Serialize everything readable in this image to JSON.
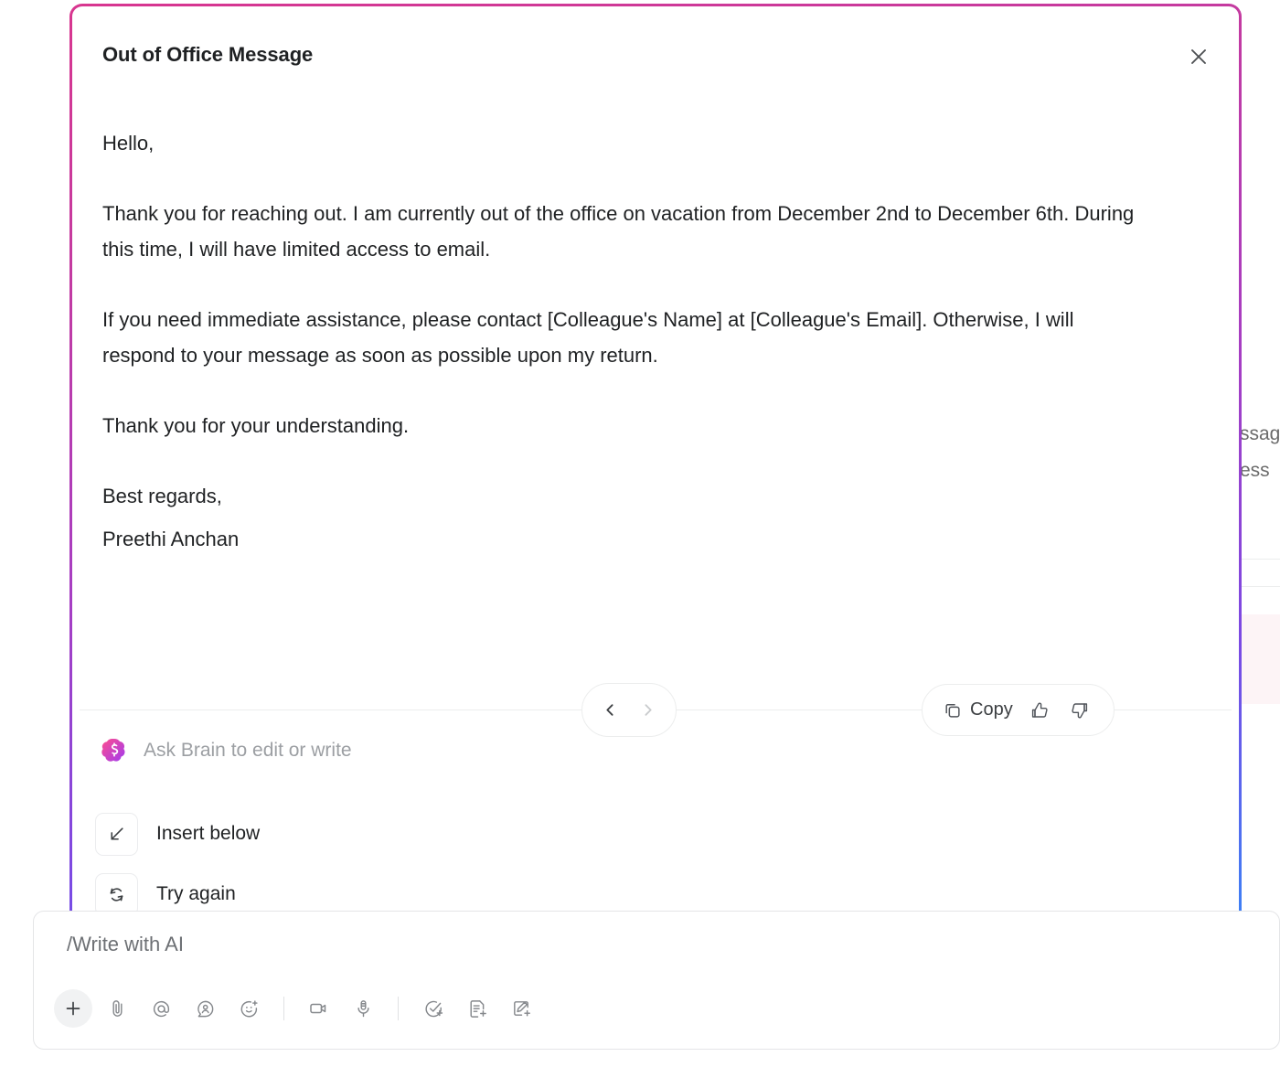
{
  "background": {
    "text_fragments": [
      "ssag",
      "ess"
    ],
    "panel_color": "#fdf4f6",
    "rule_color": "#eceded"
  },
  "modal": {
    "title": "Out of Office Message",
    "close_icon": "close-icon",
    "border_gradient_from": "#d8368f",
    "border_gradient_mid": "#a53ec4",
    "border_gradient_to": "#3b82f6",
    "body": {
      "paragraphs": [
        "Hello,",
        "Thank you for reaching out. I am currently out of the office on vacation from December 2nd to December 6th. During this time, I will have limited access to email.",
        "If you need immediate assistance, please contact [Colleague's Name] at [Colleague's Email]. Otherwise, I will respond to your message as soon as possible upon my return.",
        "Thank you for your understanding."
      ],
      "signoff": "Best regards,",
      "signature_name": "Preethi Anchan"
    },
    "controls": {
      "prev_icon": "chevron-left-icon",
      "next_icon": "chevron-right-icon",
      "copy_icon": "copy-icon",
      "copy_label": "Copy",
      "thumbs_up_icon": "thumbs-up-icon",
      "thumbs_down_icon": "thumbs-down-icon"
    },
    "ask": {
      "brain_icon": "brain-icon",
      "placeholder": "Ask Brain to edit or write",
      "brain_gradient_from": "#ff4d8d",
      "brain_gradient_to": "#a13bf0"
    },
    "actions": [
      {
        "icon": "arrow-down-left-icon",
        "label": "Insert below"
      },
      {
        "icon": "refresh-icon",
        "label": "Try again"
      }
    ]
  },
  "composer": {
    "value": "/Write with AI",
    "toolbar": [
      {
        "icon": "plus-icon",
        "name": "add-button",
        "active": true
      },
      {
        "icon": "paperclip-icon",
        "name": "attach-button",
        "active": false
      },
      {
        "icon": "at-mention-icon",
        "name": "mention-button",
        "active": false
      },
      {
        "icon": "assign-person-icon",
        "name": "assign-button",
        "active": false
      },
      {
        "icon": "emoji-plus-icon",
        "name": "emoji-button",
        "active": false
      },
      {
        "icon": "video-camera-icon",
        "name": "record-video-button",
        "active": false
      },
      {
        "icon": "microphone-icon",
        "name": "record-audio-button",
        "active": false
      },
      {
        "icon": "task-check-plus-icon",
        "name": "create-task-button",
        "active": false
      },
      {
        "icon": "doc-plus-icon",
        "name": "create-doc-button",
        "active": false
      },
      {
        "icon": "whiteboard-plus-icon",
        "name": "create-whiteboard-button",
        "active": false
      }
    ]
  }
}
